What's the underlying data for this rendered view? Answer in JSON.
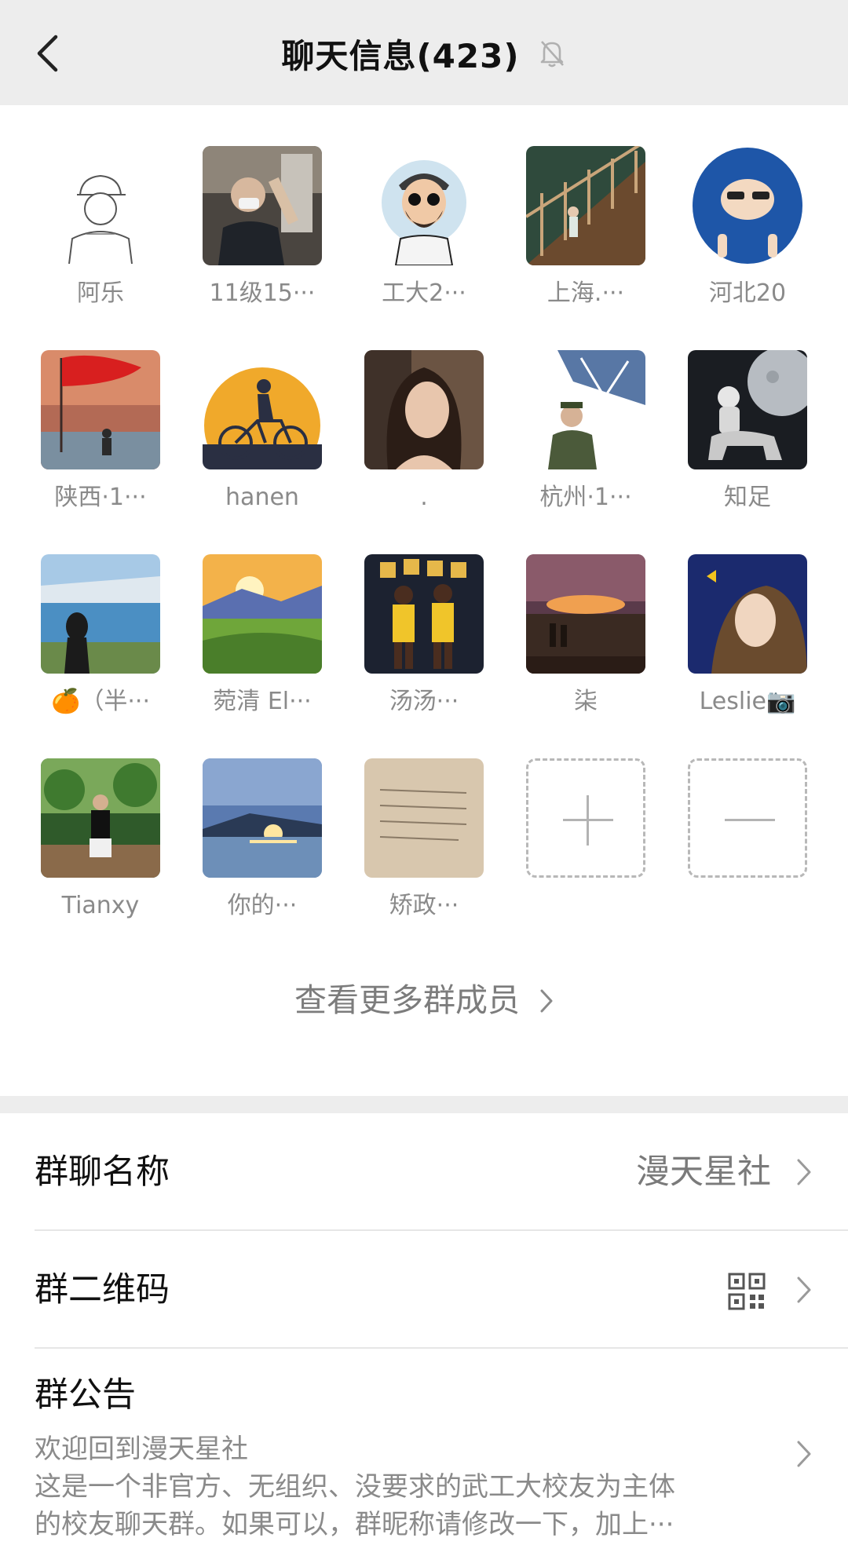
{
  "header": {
    "title": "聊天信息(423)",
    "back_icon": "chevron-left-icon",
    "mute_icon": "bell-off-icon"
  },
  "members": [
    {
      "name": "阿乐",
      "avatar": "sketch-boy-cap"
    },
    {
      "name": "11级15···",
      "avatar": "man-mask-photo"
    },
    {
      "name": "工大2···",
      "avatar": "bearded-cartoon"
    },
    {
      "name": "上海.···",
      "avatar": "stairs-photo"
    },
    {
      "name": "河北20",
      "avatar": "blue-hood-cartoon"
    },
    {
      "name": "陕西·1···",
      "avatar": "red-flag-sunset"
    },
    {
      "name": "hanen",
      "avatar": "bicycle-silhouette"
    },
    {
      "name": ".",
      "avatar": "woman-portrait"
    },
    {
      "name": "杭州·1···",
      "avatar": "soldier-photo"
    },
    {
      "name": "知足",
      "avatar": "astronaut-horse"
    },
    {
      "name": "🍊（半···",
      "avatar": "girl-lake"
    },
    {
      "name": "菀清 El···",
      "avatar": "sunset-valley"
    },
    {
      "name": "汤汤···",
      "avatar": "basketball-players"
    },
    {
      "name": "柒",
      "avatar": "sunset-field"
    },
    {
      "name": "Leslie📷",
      "avatar": "woman-blue"
    },
    {
      "name": "Tianxy",
      "avatar": "man-forest"
    },
    {
      "name": "你的···",
      "avatar": "sunset-lake"
    },
    {
      "name": "矫政···",
      "avatar": "handwriting-paper"
    }
  ],
  "add_member_icon": "plus-icon",
  "remove_member_icon": "minus-icon",
  "more_members_label": "查看更多群成员",
  "settings": {
    "group_name_label": "群聊名称",
    "group_name_value": "漫天星社",
    "qr_label": "群二维码",
    "qr_icon": "qr-code-icon",
    "notice_label": "群公告",
    "notice_lines": [
      "欢迎回到漫天星社",
      "这是一个非官方、无组织、没要求的武工大校友为主体",
      "的校友聊天群。如果可以，群昵称请修改一下，加上···"
    ]
  },
  "colors": {
    "header_bg": "#ededed",
    "muted_text": "#8a8a8a",
    "divider": "#e6e6e6"
  }
}
